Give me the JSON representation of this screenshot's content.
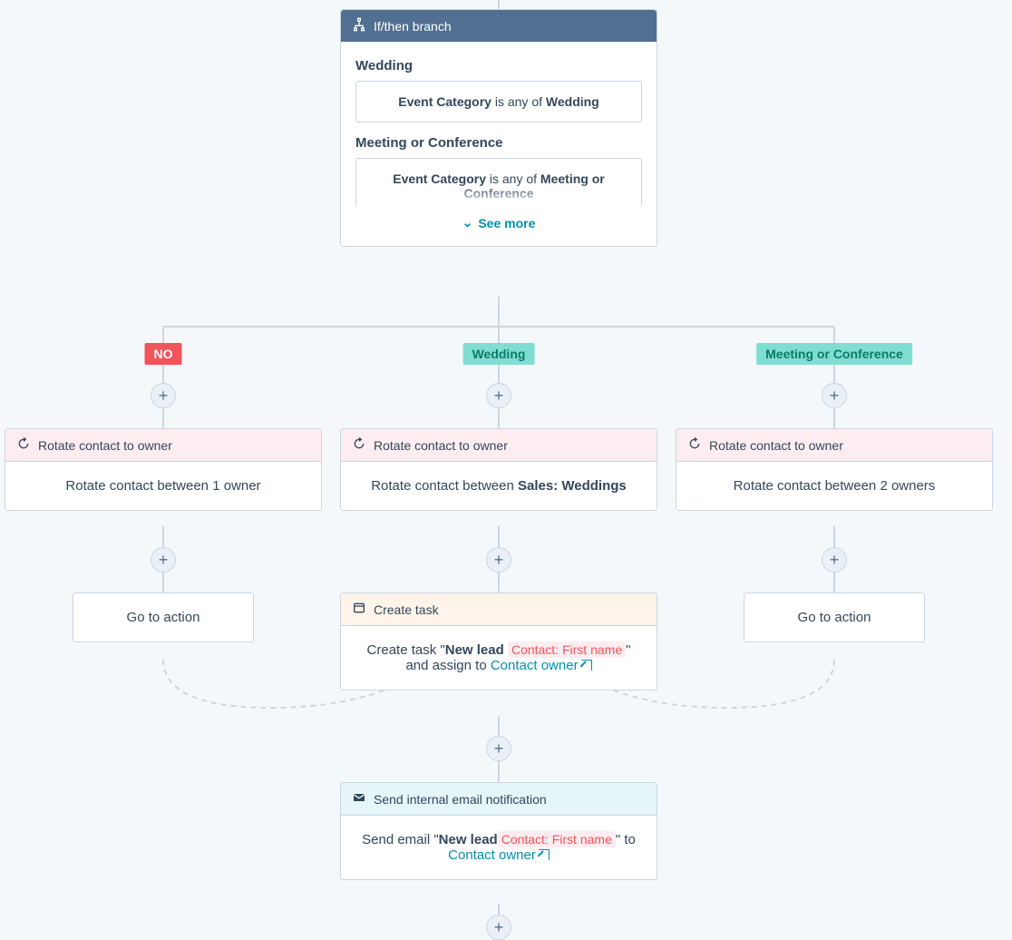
{
  "ifthen": {
    "title": "If/then branch",
    "conditions": [
      {
        "label": "Wedding",
        "prop": "Event Category",
        "op": " is any of ",
        "val": "Wedding"
      },
      {
        "label": "Meeting or Conference",
        "prop": "Event Category",
        "op": " is any of ",
        "val": "Meeting or Conference"
      }
    ],
    "see_more": "See more"
  },
  "branches": {
    "no": {
      "label": "NO"
    },
    "wedding": {
      "label": "Wedding"
    },
    "conf": {
      "label": "Meeting or Conference"
    }
  },
  "rotate": {
    "title": "Rotate contact to owner",
    "no_body": "Rotate contact between 1 owner",
    "wed_body_pre": "Rotate contact between ",
    "wed_body_bold": "Sales: Weddings",
    "conf_body": "Rotate contact between 2 owners"
  },
  "goto_label": "Go to action",
  "task": {
    "title": "Create task",
    "pre": "Create task \"",
    "bold": "New lead ",
    "token": "Contact: First name",
    "post_quote": "\"",
    "assign_pre": " and assign to ",
    "owner": "Contact owner"
  },
  "email": {
    "title": "Send internal email notification",
    "pre": "Send email \"",
    "bold": "New lead",
    "token": "Contact: First name",
    "post": "\" to",
    "owner": "Contact owner"
  }
}
